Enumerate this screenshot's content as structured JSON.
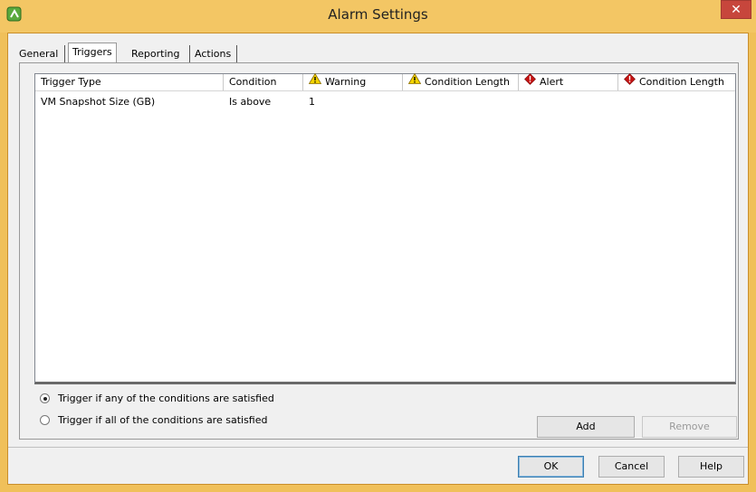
{
  "window": {
    "title": "Alarm Settings",
    "close_glyph": "✕",
    "app_icon": "vsphere-logo-icon"
  },
  "tabs": [
    "General",
    "Triggers",
    "Reporting",
    "Actions"
  ],
  "selected_tab": "Triggers",
  "table": {
    "columns": [
      {
        "label": "Trigger Type",
        "icon": ""
      },
      {
        "label": "Condition",
        "icon": ""
      },
      {
        "label": "Warning",
        "icon": "warning-icon"
      },
      {
        "label": "Condition Length",
        "icon": "warning-icon"
      },
      {
        "label": "Alert",
        "icon": "alert-icon"
      },
      {
        "label": "Condition Length",
        "icon": "alert-icon"
      }
    ],
    "rows": [
      {
        "trigger_type": "VM Snapshot Size (GB)",
        "condition": "Is above",
        "warning": "1",
        "warning_length": "",
        "alert": "",
        "alert_length": ""
      }
    ]
  },
  "options": {
    "any": {
      "label": "Trigger if any of the conditions are satisfied",
      "checked": true
    },
    "all": {
      "label": "Trigger if all of the conditions are satisfied",
      "checked": false
    }
  },
  "buttons": {
    "add": "Add",
    "remove": "Remove",
    "ok": "OK",
    "cancel": "Cancel",
    "help": "Help"
  },
  "colors": {
    "titlebar": "#f3c664",
    "close": "#c7463c",
    "warning": "#f5d400",
    "alert": "#c41212"
  }
}
